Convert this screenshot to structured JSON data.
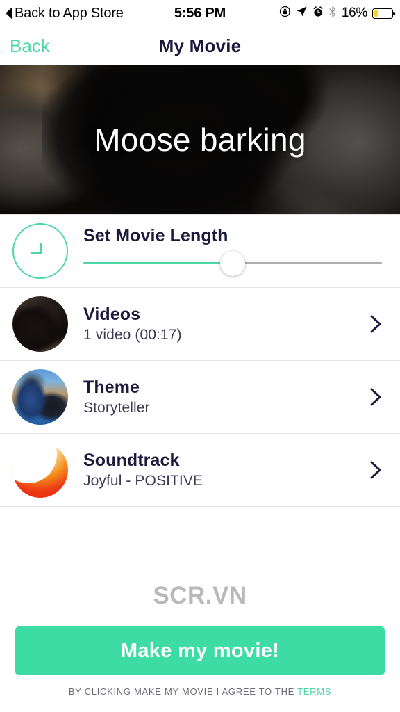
{
  "colors": {
    "mint": "#3EDCA5",
    "mint_link": "#4FD6A5",
    "navy": "#1B1A3C",
    "battery_yellow": "#FCD12A",
    "divider": "#E4E5E8",
    "watermark_grey": "#B9B9B9"
  },
  "status_bar": {
    "back_label": "Back to App Store",
    "back_icon": "back-triangle-icon",
    "time": "5:56 PM",
    "icons": [
      "rotation-lock-icon",
      "location-arrow-icon",
      "alarm-clock-icon",
      "bluetooth-icon"
    ],
    "battery_percent_label": "16%",
    "battery_level": 16
  },
  "nav_bar": {
    "back_label": "Back",
    "title": "My Movie"
  },
  "hero": {
    "movie_title": "Moose barking",
    "image_alt": "black-dog-photo"
  },
  "movie_length": {
    "icon": "clock-icon",
    "label": "Set Movie Length",
    "slider_percent": 50,
    "slider_fill_percent": 50
  },
  "rows": [
    {
      "key": "videos",
      "thumb_icon": "video-thumbnail",
      "title": "Videos",
      "subtitle": "1 video (00:17)",
      "chevron": "chevron-right-icon"
    },
    {
      "key": "theme",
      "thumb_icon": "theme-thumbnail",
      "title": "Theme",
      "subtitle": "Storyteller",
      "chevron": "chevron-right-icon"
    },
    {
      "key": "soundtrack",
      "thumb_icon": "soundtrack-thumbnail",
      "title": "Soundtrack",
      "subtitle": "Joyful - POSITIVE",
      "chevron": "chevron-right-icon"
    }
  ],
  "watermark": "SCR.VN",
  "footer": {
    "cta_label": "Make my movie!",
    "terms_prefix": "BY CLICKING MAKE MY MOVIE I AGREE TO THE ",
    "terms_link_label": "TERMS"
  }
}
